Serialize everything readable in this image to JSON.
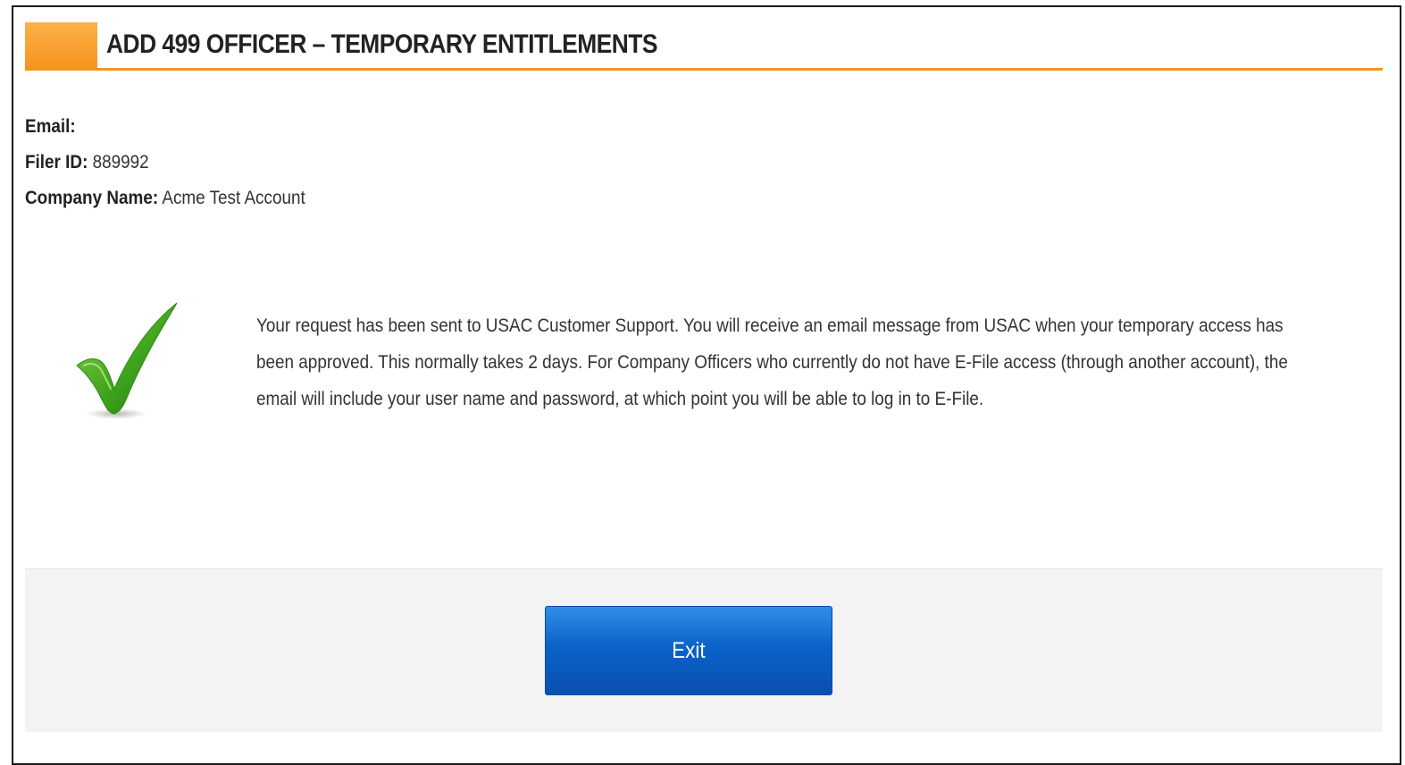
{
  "header": {
    "title": "ADD 499 OFFICER – TEMPORARY ENTITLEMENTS"
  },
  "info": {
    "email_label": "Email:",
    "email_value": "",
    "filer_id_label": "Filer ID:",
    "filer_id_value": "889992",
    "company_name_label": "Company Name:",
    "company_name_value": "Acme Test Account"
  },
  "confirmation": {
    "icon": "checkmark-icon",
    "message": "Your request has been sent to USAC Customer Support. You will receive an email message from USAC when your temporary access has been approved. This normally takes 2 days. For Company Officers who currently do not have E-File access (through another account), the email will include your user name and password, at which point you will be able to log in to E-File."
  },
  "footer": {
    "exit_label": "Exit"
  },
  "colors": {
    "accent": "#f7941d",
    "button": "#0b63c9",
    "success": "#3a9d1c"
  }
}
